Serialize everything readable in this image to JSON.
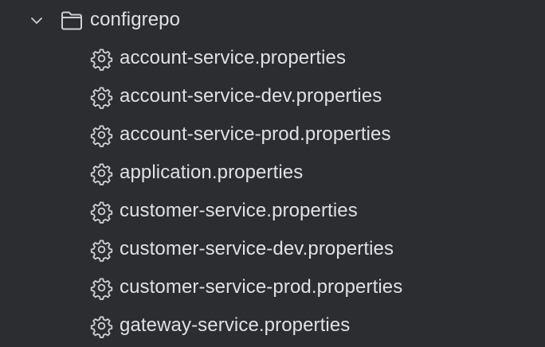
{
  "project_tree": {
    "folder": {
      "name": "configrepo",
      "expanded": true,
      "chevron_icon": "chevron-down-icon",
      "icon": "folder-icon"
    },
    "files": [
      {
        "name": "account-service.properties",
        "icon": "gear-icon"
      },
      {
        "name": "account-service-dev.properties",
        "icon": "gear-icon"
      },
      {
        "name": "account-service-prod.properties",
        "icon": "gear-icon"
      },
      {
        "name": "application.properties",
        "icon": "gear-icon"
      },
      {
        "name": "customer-service.properties",
        "icon": "gear-icon"
      },
      {
        "name": "customer-service-dev.properties",
        "icon": "gear-icon"
      },
      {
        "name": "customer-service-prod.properties",
        "icon": "gear-icon"
      },
      {
        "name": "gateway-service.properties",
        "icon": "gear-icon"
      }
    ]
  },
  "colors": {
    "background": "#2b2d30",
    "text": "#dfe1e5",
    "icon": "#ced0d6"
  }
}
